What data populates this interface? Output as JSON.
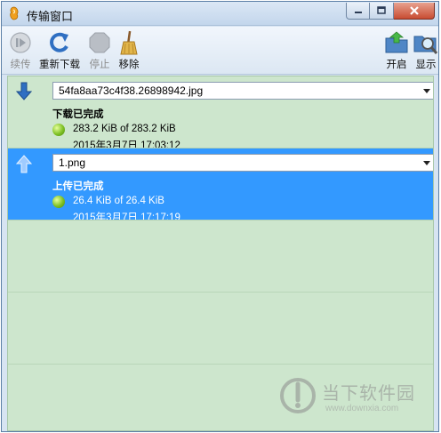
{
  "window": {
    "title": "传输窗口",
    "controls": {
      "minimize": "minimize",
      "maximize": "maximize",
      "close": "close"
    }
  },
  "toolbar": {
    "resume_label": "续传",
    "redownload_label": "重新下载",
    "stop_label": "停止",
    "remove_label": "移除",
    "open_label": "开启",
    "show_label": "显示"
  },
  "transfers": [
    {
      "direction": "download",
      "file": "54fa8aa73c4f38.26898942.jpg",
      "status": "下载已完成",
      "size": "283.2 KiB of 283.2 KiB",
      "date": "2015年3月7日 17:03:12",
      "selected": false
    },
    {
      "direction": "upload",
      "file": "1.png",
      "status": "上传已完成",
      "size": "26.4 KiB of 26.4 KiB",
      "date": "2015年3月7日 17:17:19",
      "selected": true
    }
  ],
  "watermark": {
    "title": "当下软件园",
    "url": "www.downxia.com"
  },
  "colors": {
    "list_background": "#cde6cd",
    "selected_row": "#3399ff",
    "status_dot": "#7ec024"
  }
}
